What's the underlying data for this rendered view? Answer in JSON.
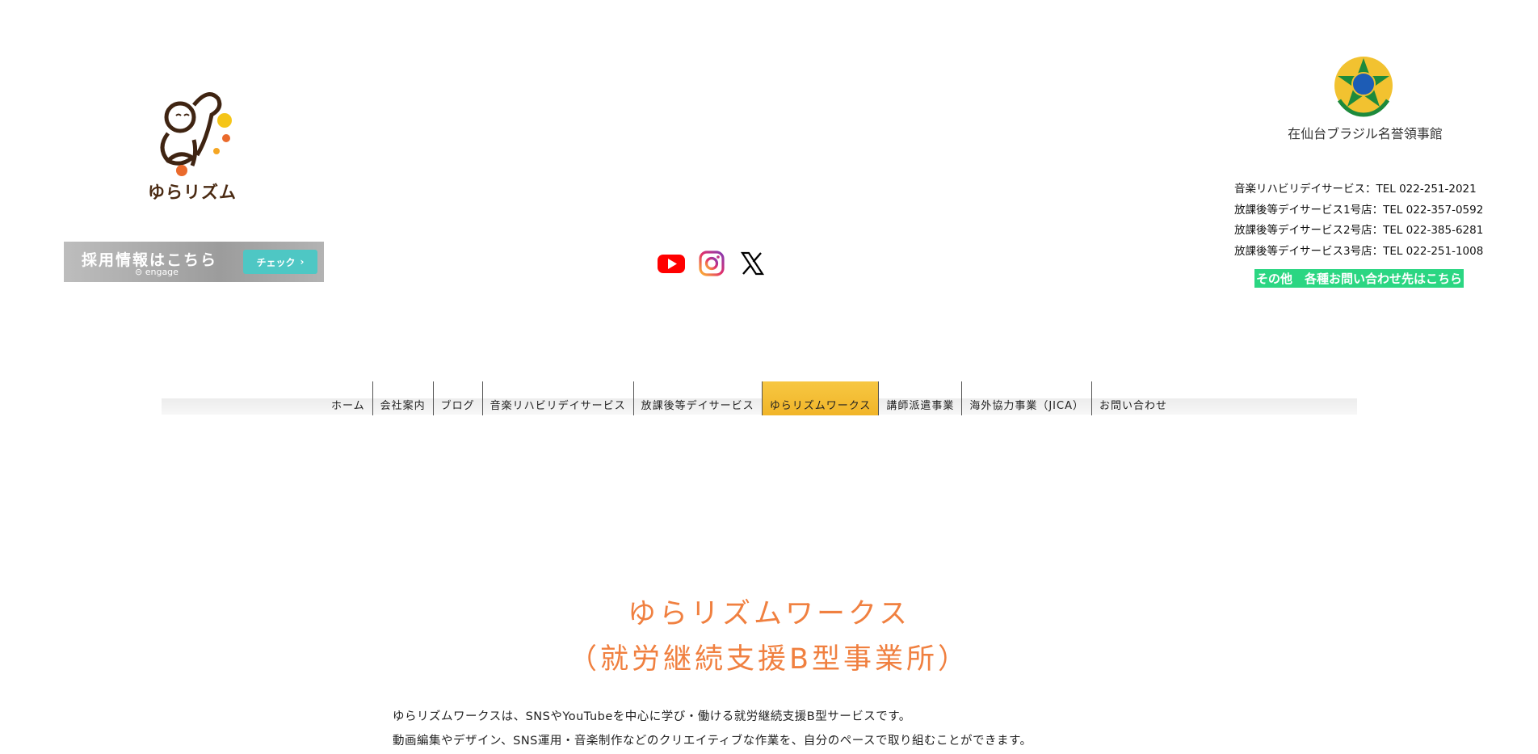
{
  "logo": {
    "text": "ゆらリズム"
  },
  "recruit": {
    "title": "採用情報はこちら",
    "engage": "engage",
    "button_label": "チェック"
  },
  "social": [
    {
      "name": "youtube-icon",
      "color": "#ff0000"
    },
    {
      "name": "instagram-icon",
      "color": "#e1306c"
    },
    {
      "name": "x-icon",
      "color": "#000000"
    }
  ],
  "consulate": {
    "name": "在仙台ブラジル名誉領事館"
  },
  "contacts": [
    "音楽リハビリデイサービス：TEL 022-251-2021",
    "放課後等デイサービス1号店：TEL 022-357-0592",
    "放課後等デイサービス2号店：TEL 022-385-6281",
    "放課後等デイサービス3号店：TEL 022-251-1008"
  ],
  "contact_link": "その他　各種お問い合わせ先はこちら",
  "nav": [
    {
      "label": "ホーム",
      "active": false
    },
    {
      "label": "会社案内",
      "active": false
    },
    {
      "label": "ブログ",
      "active": false
    },
    {
      "label": "音楽リハビリデイサービス",
      "active": false
    },
    {
      "label": "放課後等デイサービス",
      "active": false
    },
    {
      "label": "ゆらリズムワークス",
      "active": true
    },
    {
      "label": "講師派遣事業",
      "active": false
    },
    {
      "label": "海外協力事業（JICA）",
      "active": false
    },
    {
      "label": "お問い合わせ",
      "active": false
    }
  ],
  "main": {
    "title_line1": "ゆらリズムワークス",
    "title_line2": "（就労継続支援B型事業所）",
    "desc_line1": "ゆらリズムワークスは、SNSやYouTubeを中心に学び・働ける就労継続支援B型サービスです。",
    "desc_line2": "動画編集やデザイン、SNS運用・音楽制作などのクリエイティブな作業を、自分のペースで取り組むことができます。"
  },
  "colors": {
    "accent_orange": "#f08040",
    "nav_active": "#f5bf35",
    "contact_green": "#2bd682",
    "recruit_button": "#4ec7c4"
  }
}
